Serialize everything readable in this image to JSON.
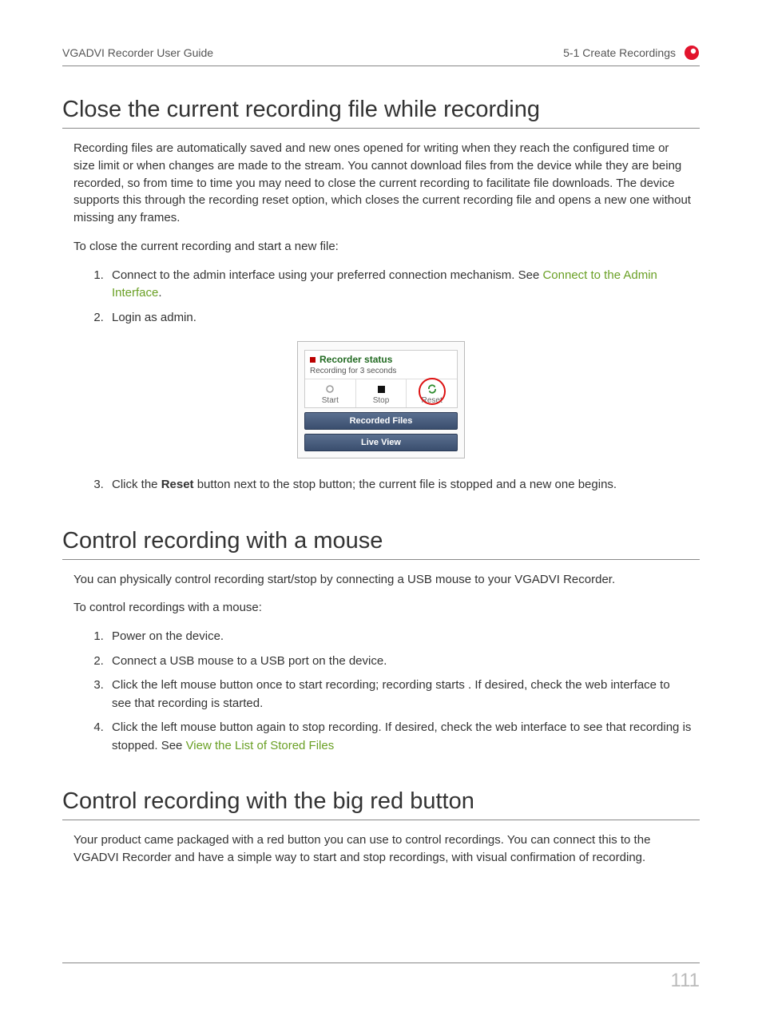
{
  "header": {
    "left": "VGADVI Recorder User Guide",
    "right": "5-1 Create Recordings"
  },
  "section1": {
    "title": "Close the current recording file while recording",
    "para1": "Recording files are automatically saved and new ones opened for writing when they reach the configured time or size limit or when changes are made to the stream. You cannot download files from the device while they are being recorded, so from time to time you may need to close the current recording to facilitate file downloads. The device supports this through the recording reset option, which closes the current recording file and opens a new one without missing any frames.",
    "para2": "To close the current recording and start a new file:",
    "step1_a": "Connect to the admin interface using your preferred connection mechanism. See ",
    "step1_link": "Connect to the Admin Interface",
    "step1_b": ".",
    "step2": "Login as admin.",
    "step3_a": "Click the ",
    "step3_bold": "Reset",
    "step3_b": " button next to the stop button; the current file is stopped and a new one begins."
  },
  "figure": {
    "status_title": "Recorder status",
    "status_sub": "Recording for 3 seconds",
    "btn_start": "Start",
    "btn_stop": "Stop",
    "btn_reset": "Reset",
    "recorded_files": "Recorded Files",
    "live_view": "Live View"
  },
  "section2": {
    "title": "Control recording with a mouse",
    "para1": "You can physically control recording start/stop by connecting a USB mouse to your VGADVI Recorder.",
    "para2": "To control recordings with a mouse:",
    "step1": "Power on the device.",
    "step2": "Connect a USB mouse to a USB port on the device.",
    "step3": "Click the left mouse button once to start recording; recording starts . If desired, check the web interface to see that recording is started.",
    "step4_a": "Click the left mouse button again to stop recording. If desired, check the web interface to see that recording is stopped. See ",
    "step4_link": "View the List of Stored Files"
  },
  "section3": {
    "title": "Control recording with the big red button",
    "para1": "Your product came packaged with a red button you can use to control recordings. You can connect this to the VGADVI Recorder and have a simple way to start and stop recordings, with visual confirmation of recording."
  },
  "page_number": "111"
}
